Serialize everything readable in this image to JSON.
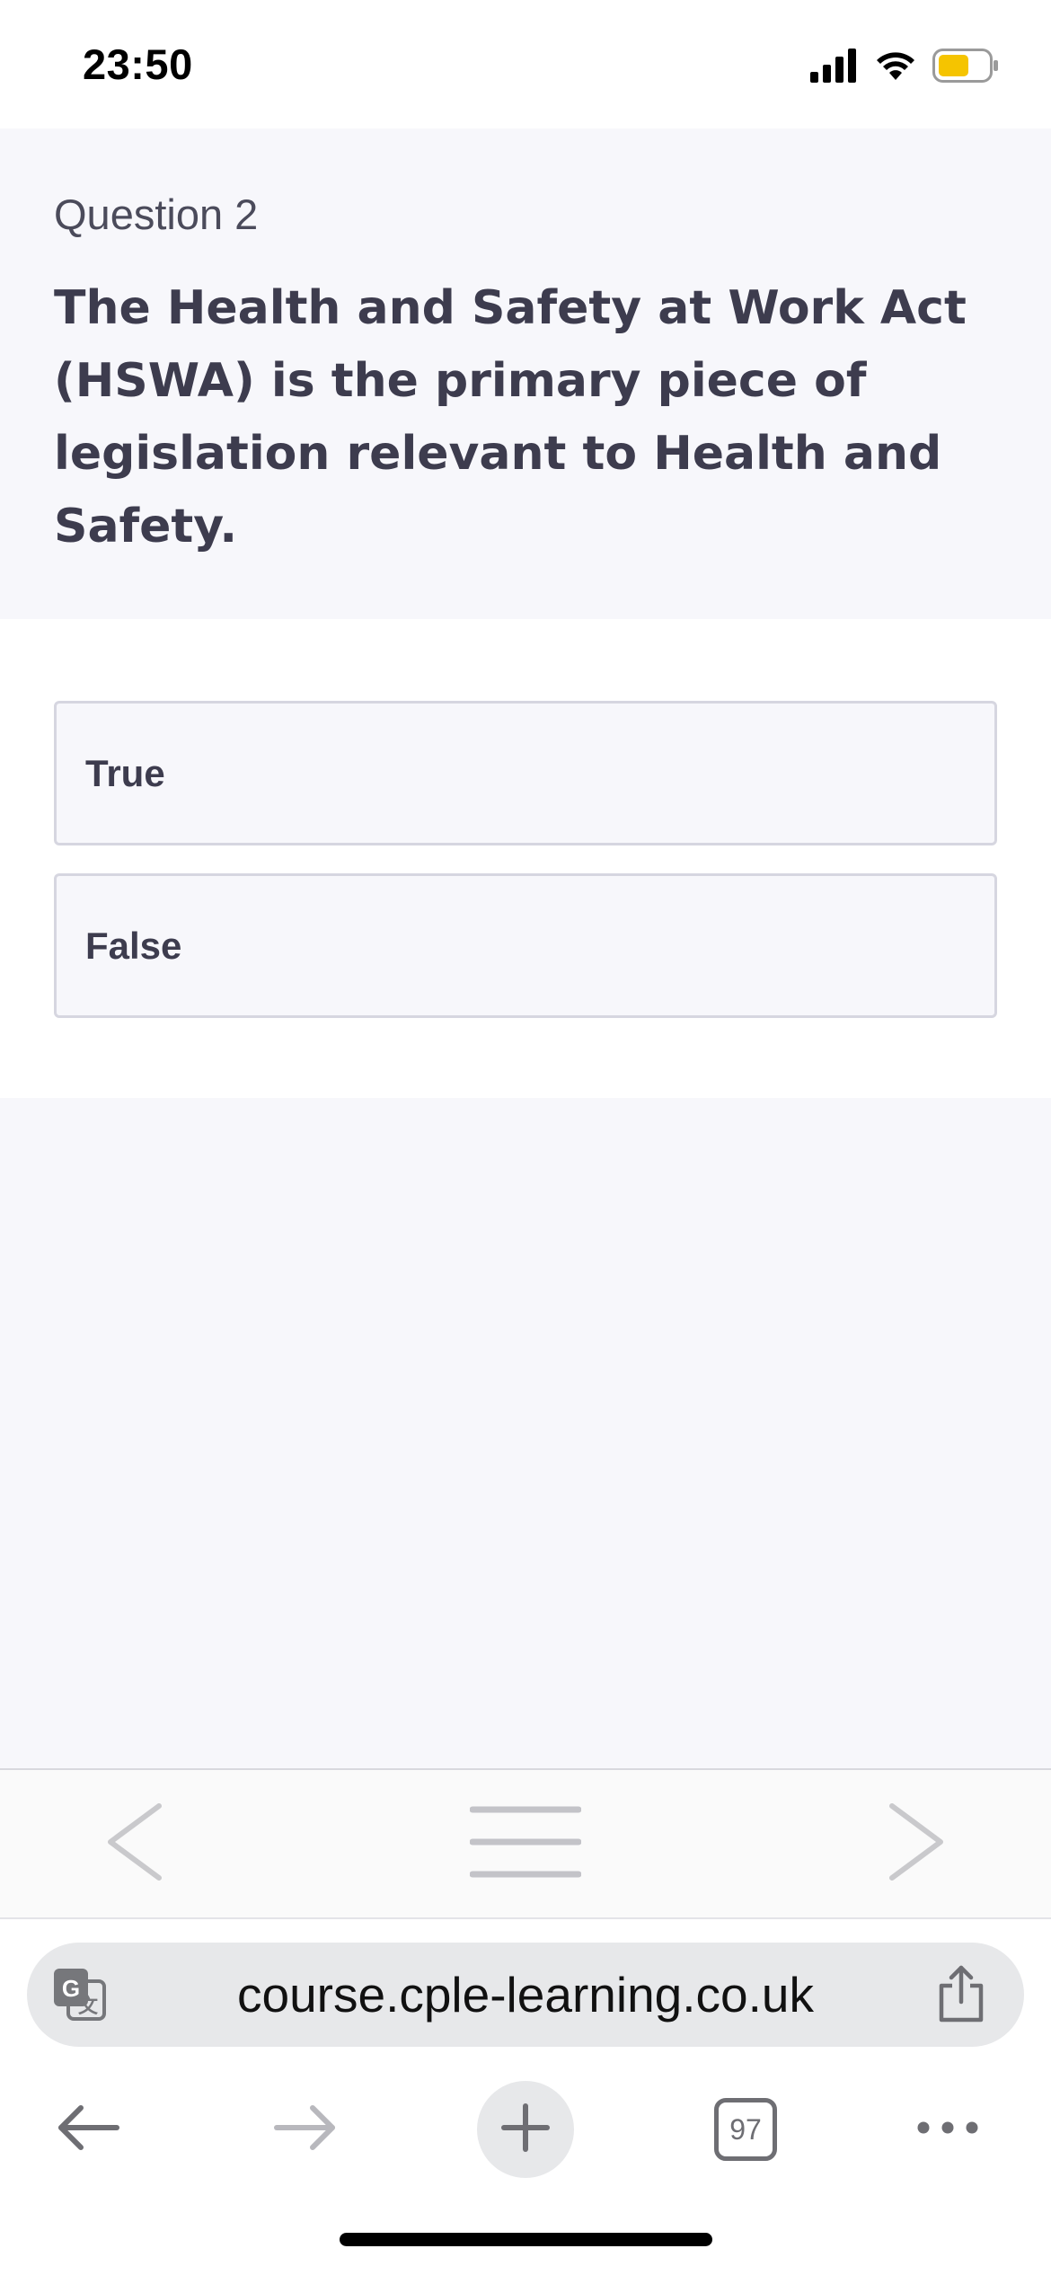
{
  "status_bar": {
    "time": "23:50",
    "signal_icon": "cellular-signal-icon",
    "wifi_icon": "wifi-icon",
    "battery_icon": "battery-icon",
    "battery_color": "#f5c400"
  },
  "question": {
    "number_label": "Question 2",
    "text": "The Health and Safety at Work Act (HSWA) is the primary piece of legislation relevant to Health and Safety."
  },
  "answers": [
    {
      "label": "True"
    },
    {
      "label": "False"
    }
  ],
  "lesson_nav": {
    "prev_icon": "chevron-left-icon",
    "menu_icon": "menu-icon",
    "next_icon": "chevron-right-icon"
  },
  "browser": {
    "url": "course.cple-learning.co.uk",
    "translate_icon": "translate-icon",
    "share_icon": "share-icon",
    "back_icon": "arrow-left-icon",
    "forward_icon": "arrow-right-icon",
    "new_tab_icon": "plus-icon",
    "tab_count": "97",
    "more_icon": "more-icon"
  },
  "colors": {
    "question_text": "#3d3c4e",
    "panel_background": "#f7f7fb",
    "option_border": "#d6d6e0"
  }
}
